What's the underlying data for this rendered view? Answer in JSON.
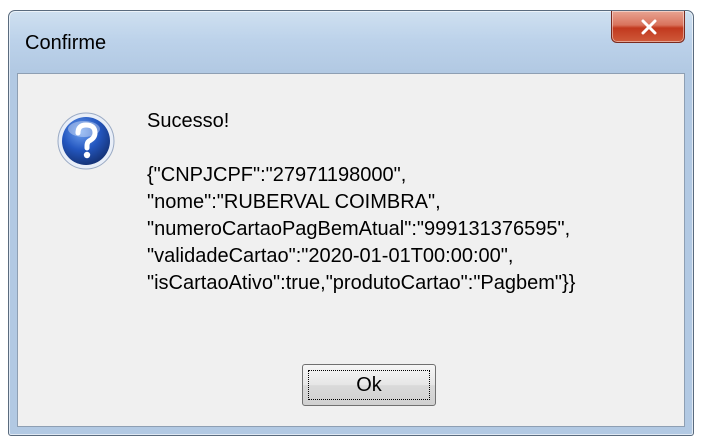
{
  "window": {
    "title": "Confirme",
    "close_symbol": "x"
  },
  "dialog": {
    "icon": "question-icon",
    "heading": "Sucesso!",
    "lines": [
      "{\"CNPJCPF\":\"27971198000\",",
      "\"nome\":\"RUBERVAL COIMBRA\",",
      "\"numeroCartaoPagBemAtual\":\"999131376595\",",
      "\"validadeCartao\":\"2020-01-01T00:00:00\",",
      "\"isCartaoAtivo\":true,\"produtoCartao\":\"Pagbem\"}}"
    ],
    "ok_label": "Ok"
  },
  "colors": {
    "close_button": "#c2391e",
    "icon_blue": "#1f4fa8",
    "client_bg": "#f0f0f0"
  }
}
